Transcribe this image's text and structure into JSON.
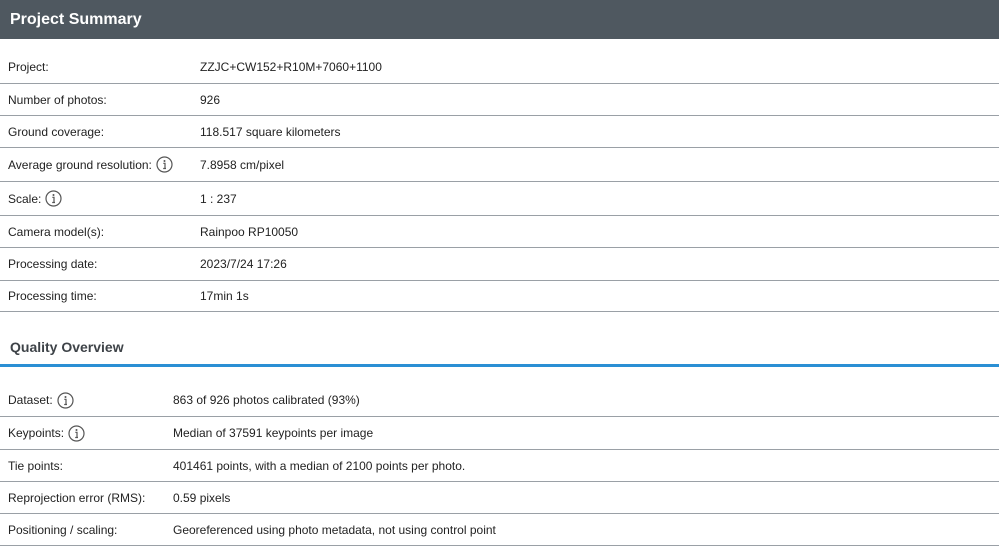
{
  "header": {
    "title": "Project Summary"
  },
  "summary": {
    "rows": [
      {
        "label": "Project:",
        "value": "ZZJC+CW152+R10M+7060+1100"
      },
      {
        "label": "Number of photos:",
        "value": "926"
      },
      {
        "label": "Ground coverage:",
        "value": "118.517 square kilometers"
      },
      {
        "label": "Average ground resolution:",
        "value": "7.8958 cm/pixel"
      },
      {
        "label": "Scale:",
        "value": "1 : 237"
      },
      {
        "label": "Camera model(s):",
        "value": "Rainpoo RP10050"
      },
      {
        "label": "Processing date:",
        "value": "2023/7/24 17:26"
      },
      {
        "label": "Processing time:",
        "value": "17min 1s"
      }
    ]
  },
  "quality": {
    "title": "Quality Overview",
    "rows": [
      {
        "label": "Dataset:",
        "value": "863 of 926 photos calibrated (93%)"
      },
      {
        "label": "Keypoints:",
        "value": "Median of 37591 keypoints per image"
      },
      {
        "label": "Tie points:",
        "value": "401461 points, with a median of 2100 points per photo."
      },
      {
        "label": "Reprojection error (RMS):",
        "value": "0.59 pixels"
      },
      {
        "label": "Positioning / scaling:",
        "value": "Georeferenced using photo metadata, not using control point"
      }
    ]
  },
  "colors": {
    "header_bg": "#4f5860",
    "accent": "#2a8fd4",
    "row_border": "#9aa0a6"
  },
  "icons": {
    "info": "info-circle-icon"
  }
}
